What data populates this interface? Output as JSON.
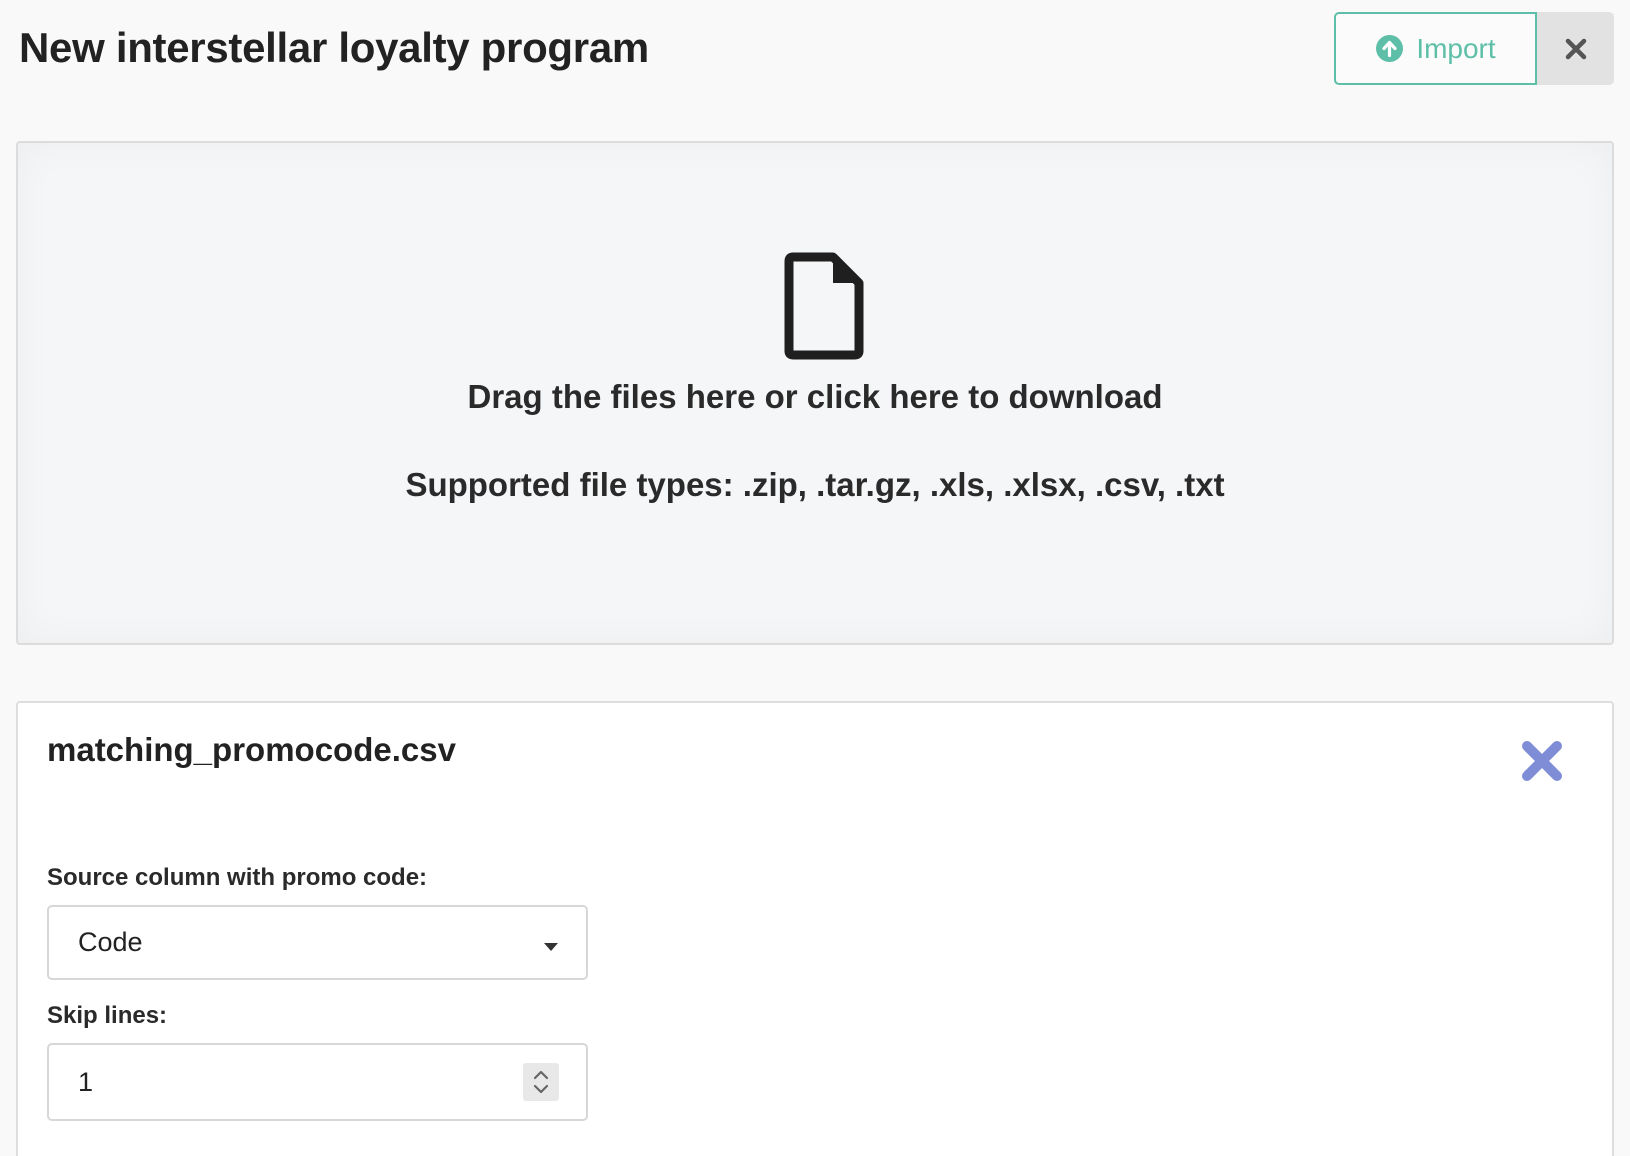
{
  "header": {
    "title": "New interstellar loyalty program",
    "import_label": "Import",
    "import_icon": "arrow-up-circle-icon",
    "close_icon": "close-icon",
    "accent_color": "#5dbfa7"
  },
  "dropzone": {
    "icon": "file-icon",
    "primary_text": "Drag the files here or click here to download",
    "secondary_text": "Supported file types: .zip, .tar.gz, .xls, .xlsx, .csv, .txt"
  },
  "file_panel": {
    "file_name": "matching_promocode.csv",
    "remove_icon": "remove-file-icon",
    "remove_color": "#7f8dd6",
    "source_column": {
      "label": "Source column with promo code:",
      "selected": "Code"
    },
    "skip_lines": {
      "label": "Skip lines:",
      "value": "1"
    }
  }
}
